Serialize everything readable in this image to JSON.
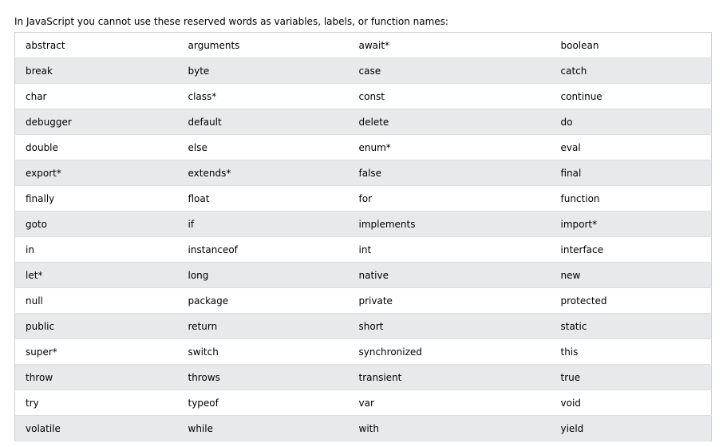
{
  "intro": "In JavaScript you cannot use these reserved words as variables, labels, or function names:",
  "table": {
    "rows": [
      [
        "abstract",
        "arguments",
        "await*",
        "boolean"
      ],
      [
        "break",
        "byte",
        "case",
        "catch"
      ],
      [
        "char",
        "class*",
        "const",
        "continue"
      ],
      [
        "debugger",
        "default",
        "delete",
        "do"
      ],
      [
        "double",
        "else",
        "enum*",
        "eval"
      ],
      [
        "export*",
        "extends*",
        "false",
        "final"
      ],
      [
        "finally",
        "float",
        "for",
        "function"
      ],
      [
        "goto",
        "if",
        "implements",
        "import*"
      ],
      [
        "in",
        "instanceof",
        "int",
        "interface"
      ],
      [
        "let*",
        "long",
        "native",
        "new"
      ],
      [
        "null",
        "package",
        "private",
        "protected"
      ],
      [
        "public",
        "return",
        "short",
        "static"
      ],
      [
        "super*",
        "switch",
        "synchronized",
        "this"
      ],
      [
        "throw",
        "throws",
        "transient",
        "true"
      ],
      [
        "try",
        "typeof",
        "var",
        "void"
      ],
      [
        "volatile",
        "while",
        "with",
        "yield"
      ]
    ]
  },
  "colors": {
    "stripe": "#e7e9eb",
    "border": "#cccccc",
    "text": "#000000"
  }
}
